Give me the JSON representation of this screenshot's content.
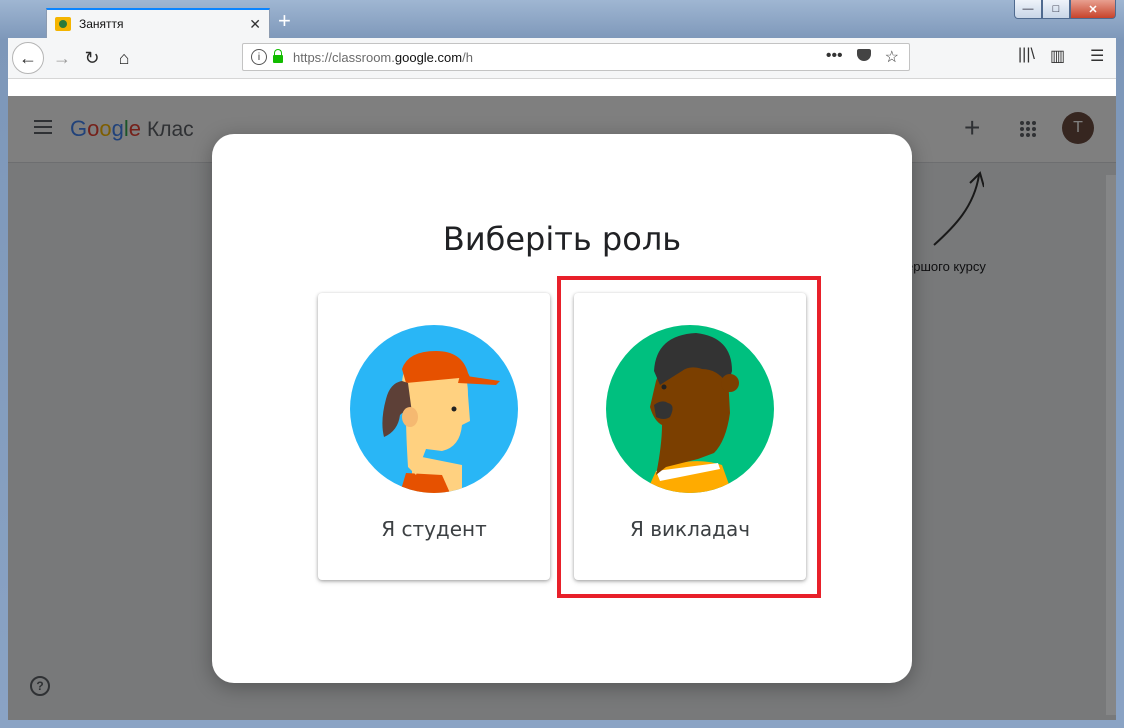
{
  "browser": {
    "tab_title": "Заняття",
    "url_prefix": "https://classroom.",
    "url_domain": "google.com",
    "url_suffix": "/h"
  },
  "app": {
    "logo_letters": [
      "G",
      "o",
      "o",
      "g",
      "l",
      "e"
    ],
    "product_name": "Клас",
    "avatar_letter": "Т",
    "hint_text": "ершого курсу"
  },
  "dialog": {
    "title": "Виберіть роль",
    "options": [
      {
        "label": "Я студент"
      },
      {
        "label": "Я викладач"
      }
    ],
    "highlighted_option": "Я викладач"
  },
  "colors": {
    "highlight": "#e8202a",
    "student_bg": "#29b6f6",
    "teacher_bg": "#00c07f"
  }
}
